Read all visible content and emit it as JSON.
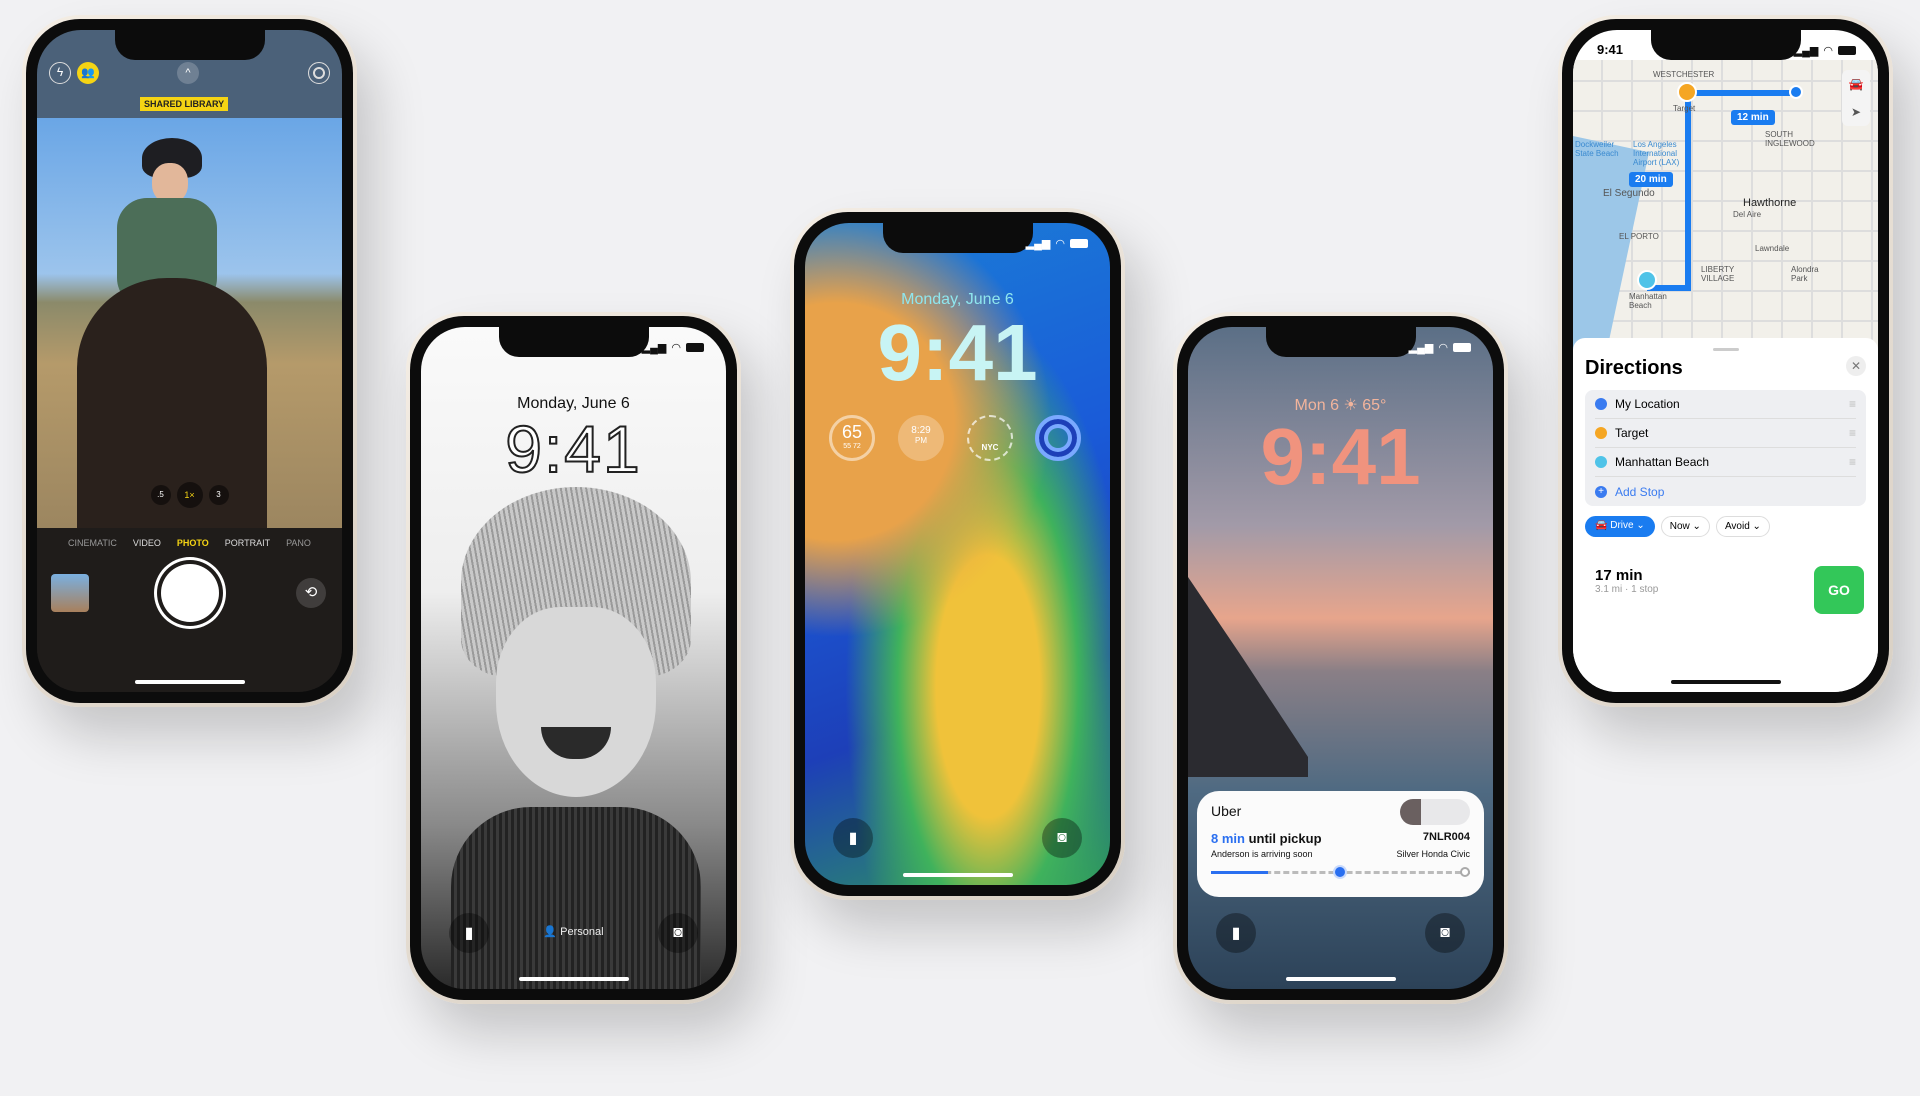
{
  "camera_phone": {
    "badge": "SHARED LIBRARY",
    "zoom_levels": [
      ".5",
      "1×",
      "3"
    ],
    "modes": [
      "CINEMATIC",
      "VIDEO",
      "PHOTO",
      "PORTRAIT",
      "PANO"
    ],
    "active_mode": "PHOTO",
    "accent": "#f5d414"
  },
  "bw_phone": {
    "date": "Monday, June 6",
    "time": "9:41",
    "focus": "Personal"
  },
  "color_phone": {
    "date": "Monday, June 6",
    "time": "9:41",
    "widgets": {
      "temp": "65",
      "low": "55",
      "high": "72",
      "sunset_time": "8:29",
      "sunset_period": "PM",
      "clock_city": "NYC"
    }
  },
  "sunset_phone": {
    "date_weather": "Mon 6 ☀ 65°",
    "time": "9:41",
    "activity": {
      "app": "Uber",
      "eta": "8 min",
      "eta_suffix": " until pickup",
      "subtitle": "Anderson is arriving soon",
      "plate": "7NLR004",
      "car": "Silver Honda Civic",
      "progress": 0.22
    }
  },
  "maps_phone": {
    "status_time": "9:41",
    "map_labels": [
      "WESTCHESTER",
      "Target",
      "12 min",
      "20 min",
      "SOUTH INGLEWOOD",
      "Dockweiler State Beach",
      "Los Angeles International Airport (LAX)",
      "El Segundo",
      "Hawthorne",
      "Del Aire",
      "EL PORTO",
      "Lawndale",
      "Manhattan Beach",
      "LIBERTY VILLAGE",
      "Alondra Park"
    ],
    "panel": {
      "title": "Directions",
      "stops": [
        "My Location",
        "Target",
        "Manhattan Beach"
      ],
      "add_stop": "Add Stop",
      "chips": [
        "Drive",
        "Now",
        "Avoid"
      ],
      "duration": "17 min",
      "detail": "3.1 mi · 1 stop",
      "go": "GO"
    }
  }
}
